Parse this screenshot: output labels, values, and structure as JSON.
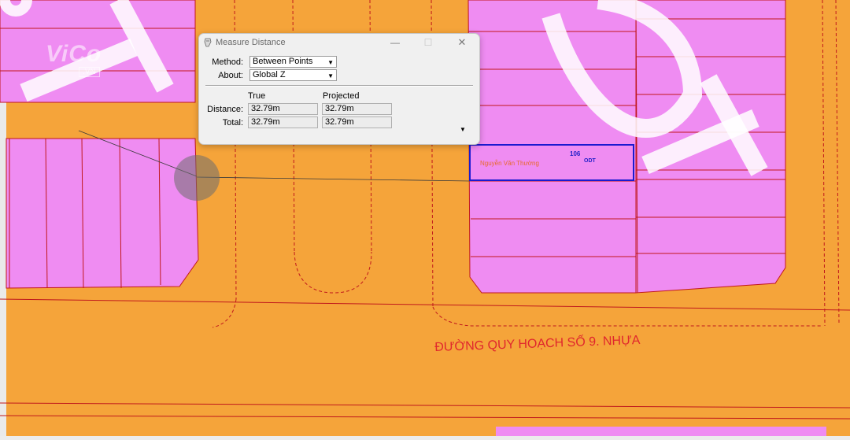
{
  "map": {
    "road_label": "ĐƯỜNG QUY HOẠCH SỐ 9. NHỰA",
    "watermark": "ViCo",
    "watermark_sub": ".VN",
    "colors": {
      "road": "#f5a43a",
      "plot": "#ef8cf2",
      "boundary": "#c0181c",
      "selection": "#1a1ad0"
    },
    "selected_lot": {
      "owner": "Nguyễn  Văn  Thường",
      "number": "106",
      "code": "ODT"
    }
  },
  "dialog": {
    "title": "Measure Distance",
    "icon": "measure-tool-icon",
    "method": {
      "label": "Method:",
      "value": "Between Points"
    },
    "about": {
      "label": "About:",
      "value": "Global Z"
    },
    "headers": {
      "true": "True",
      "projected": "Projected"
    },
    "rows": [
      {
        "label": "Distance:",
        "true": "32.79m",
        "projected": "32.79m"
      },
      {
        "label": "Total:",
        "true": "32.79m",
        "projected": "32.79m"
      }
    ]
  }
}
